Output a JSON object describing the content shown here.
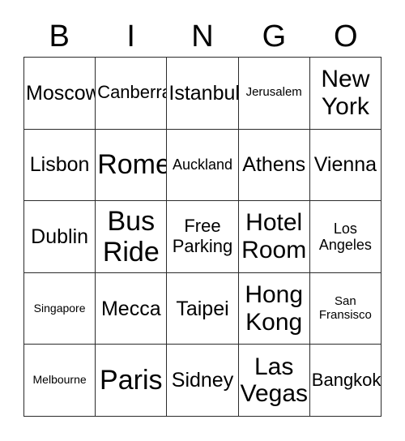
{
  "card": {
    "title": "BINGO",
    "header_letters": [
      "B",
      "I",
      "N",
      "G",
      "O"
    ],
    "grid": {
      "columns": 5,
      "rows": 5,
      "border_color": "#2b2b2b",
      "background_color": "#ffffff",
      "text_color": "#000000"
    },
    "cells": [
      [
        {
          "label": "Moscow",
          "size": "lg"
        },
        {
          "label": "Canberra",
          "size": "md"
        },
        {
          "label": "Istanbul",
          "size": "lg"
        },
        {
          "label": "Jerusalem",
          "size": "xs"
        },
        {
          "label": "New\nYork",
          "size": "xl"
        }
      ],
      [
        {
          "label": "Lisbon",
          "size": "lg"
        },
        {
          "label": "Rome",
          "size": "xxl"
        },
        {
          "label": "Auckland",
          "size": "sm"
        },
        {
          "label": "Athens",
          "size": "lg"
        },
        {
          "label": "Vienna",
          "size": "lg"
        }
      ],
      [
        {
          "label": "Dublin",
          "size": "lg"
        },
        {
          "label": "Bus\nRide",
          "size": "xxl"
        },
        {
          "label": "Free\nParking",
          "size": "md"
        },
        {
          "label": "Hotel\nRoom",
          "size": "xl"
        },
        {
          "label": "Los\nAngeles",
          "size": "sm"
        }
      ],
      [
        {
          "label": "Singapore",
          "size": "xxs"
        },
        {
          "label": "Mecca",
          "size": "lg"
        },
        {
          "label": "Taipei",
          "size": "lg"
        },
        {
          "label": "Hong\nKong",
          "size": "xl"
        },
        {
          "label": "San\nFransisco",
          "size": "xs"
        }
      ],
      [
        {
          "label": "Melbourne",
          "size": "xxs"
        },
        {
          "label": "Paris",
          "size": "xxl"
        },
        {
          "label": "Sidney",
          "size": "lg"
        },
        {
          "label": "Las\nVegas",
          "size": "xl"
        },
        {
          "label": "Bangkok",
          "size": "md"
        }
      ]
    ]
  }
}
